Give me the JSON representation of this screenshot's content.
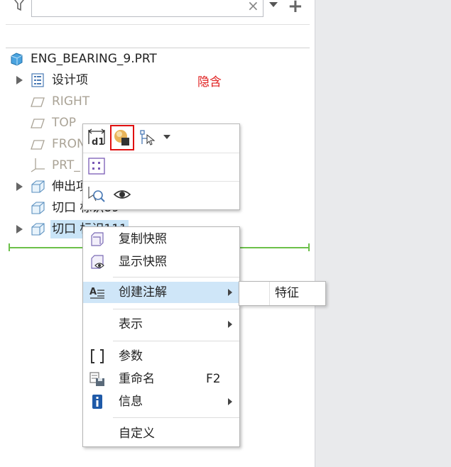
{
  "filter": {
    "search_value": "",
    "clear_glyph": "×",
    "add_glyph": "+"
  },
  "tree": {
    "root_label": "ENG_BEARING_9.PRT",
    "items": [
      {
        "label": "设计项",
        "style": "normal"
      },
      {
        "label": "RIGHT",
        "style": "datum"
      },
      {
        "label": "TOP",
        "style": "datum"
      },
      {
        "label": "FRON",
        "style": "datum"
      },
      {
        "label": "PRT_",
        "style": "datum"
      },
      {
        "label": "伸出项",
        "style": "normal"
      },
      {
        "label": "切口 标识89",
        "style": "normal"
      },
      {
        "label": "切口 标识111",
        "style": "selected"
      }
    ],
    "hidden_text": "隐含",
    "hidden_color": "#e02020"
  },
  "mini_toolbar": {
    "row1": [
      "dimension-icon",
      "appearance-icon",
      "select-dropdown-icon"
    ],
    "row2": [
      "pattern-icon"
    ],
    "row3": [
      "zoom-to-selected-icon",
      "show-icon"
    ],
    "highlight_color": "#e01010"
  },
  "context_menu": {
    "items": [
      {
        "label": "复制快照",
        "icon": "copy-snapshot-icon"
      },
      {
        "label": "显示快照",
        "icon": "show-snapshot-icon"
      },
      {
        "label": "创建注解",
        "icon": "annotation-icon",
        "submenu": true,
        "hover": true
      },
      {
        "label": "表示",
        "submenu": true
      },
      {
        "label": "参数",
        "icon": "parameters-icon"
      },
      {
        "label": "重命名",
        "icon": "rename-icon",
        "accelerator": "F2"
      },
      {
        "label": "信息",
        "icon": "info-icon",
        "submenu": true
      },
      {
        "label": "自定义"
      }
    ],
    "submenu": {
      "items": [
        "特征"
      ]
    },
    "hover_color": "#cfe6f8"
  },
  "colors": {
    "selection": "#c9e4f7",
    "accent_green": "#6cc04a",
    "side_pane": "#e9eaec"
  }
}
